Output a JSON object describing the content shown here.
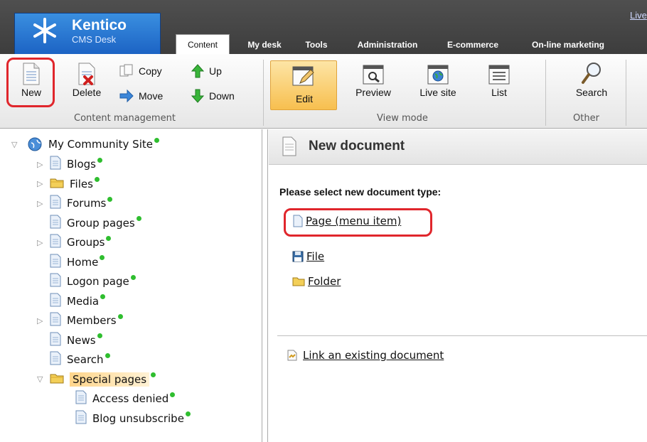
{
  "app": {
    "brand": "Kentico",
    "product": "CMS Desk",
    "live_link": "Live"
  },
  "tabs": [
    {
      "label": "Content",
      "active": true
    },
    {
      "label": "My desk"
    },
    {
      "label": "Tools"
    },
    {
      "label": "Administration"
    },
    {
      "label": "E-commerce"
    },
    {
      "label": "On-line marketing"
    }
  ],
  "toolbar": {
    "new": "New",
    "delete": "Delete",
    "copy": "Copy",
    "move": "Move",
    "up": "Up",
    "down": "Down",
    "group_content": "Content management",
    "edit": "Edit",
    "preview": "Preview",
    "live_site": "Live site",
    "list": "List",
    "group_view": "View mode",
    "search": "Search",
    "group_other": "Other"
  },
  "tree": {
    "root": "My Community Site",
    "items": [
      {
        "label": "Blogs",
        "icon": "page-icon",
        "expandable": true
      },
      {
        "label": "Files",
        "icon": "folder-icon",
        "expandable": true
      },
      {
        "label": "Forums",
        "icon": "page-icon",
        "expandable": true
      },
      {
        "label": "Group pages",
        "icon": "page-icon",
        "expandable": false
      },
      {
        "label": "Groups",
        "icon": "page-icon",
        "expandable": true
      },
      {
        "label": "Home",
        "icon": "page-icon",
        "expandable": false
      },
      {
        "label": "Logon page",
        "icon": "page-icon",
        "expandable": false
      },
      {
        "label": "Media",
        "icon": "page-icon",
        "expandable": false
      },
      {
        "label": "Members",
        "icon": "page-icon",
        "expandable": true
      },
      {
        "label": "News",
        "icon": "page-icon",
        "expandable": false
      },
      {
        "label": "Search",
        "icon": "page-icon",
        "expandable": false
      },
      {
        "label": "Special pages",
        "icon": "folder-icon",
        "expanded": true,
        "selected": true
      },
      {
        "label": "Access denied",
        "icon": "page-icon",
        "child": true
      },
      {
        "label": "Blog unsubscribe",
        "icon": "page-icon",
        "child": true
      }
    ]
  },
  "content": {
    "title": "New document",
    "prompt": "Please select new document type:",
    "types": [
      {
        "label": "Page (menu item)",
        "icon": "page-icon"
      },
      {
        "label": "File",
        "icon": "floppy-icon"
      },
      {
        "label": "Folder",
        "icon": "folder-icon"
      }
    ],
    "link_existing": "Link an existing document"
  },
  "colors": {
    "highlight_ring": "#e0262c",
    "status_dot": "#2fbe2f",
    "edit_active": "#f7bf4f"
  }
}
